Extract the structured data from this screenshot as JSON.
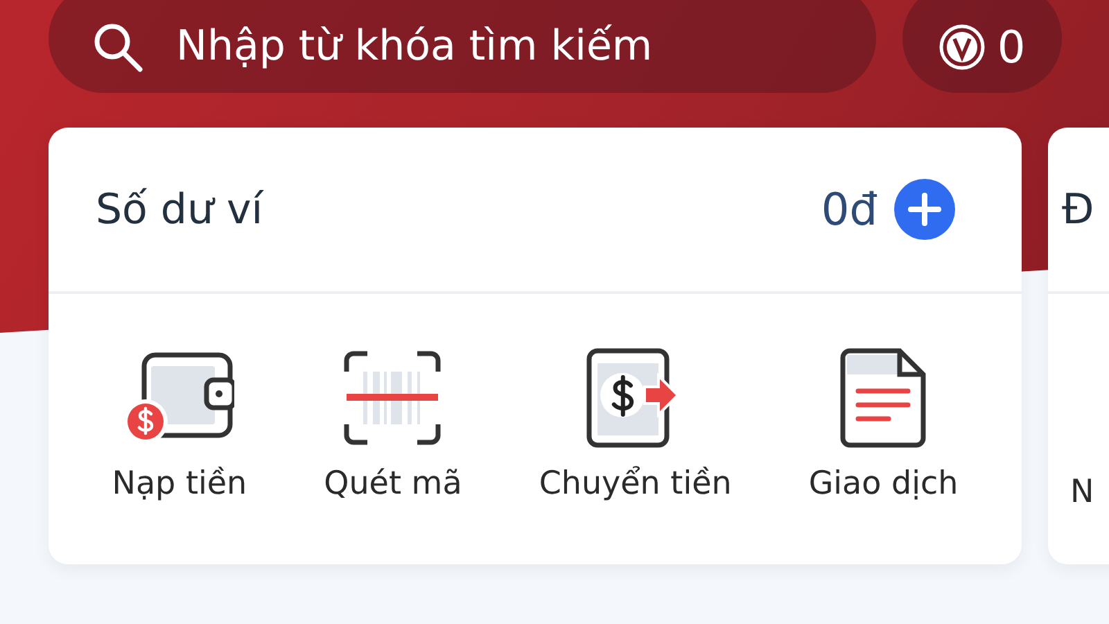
{
  "search": {
    "placeholder": "Nhập từ khóa tìm kiếm"
  },
  "points": {
    "value": "0"
  },
  "wallet_card": {
    "title": "Số dư ví",
    "balance": "0đ",
    "actions": [
      {
        "kind": "topup",
        "label": "Nạp tiền"
      },
      {
        "kind": "scan",
        "label": "Quét mã"
      },
      {
        "kind": "transfer",
        "label": "Chuyển tiền"
      },
      {
        "kind": "history",
        "label": "Giao dịch"
      }
    ]
  },
  "next_card": {
    "title": "Đ",
    "action_label": "N"
  }
}
